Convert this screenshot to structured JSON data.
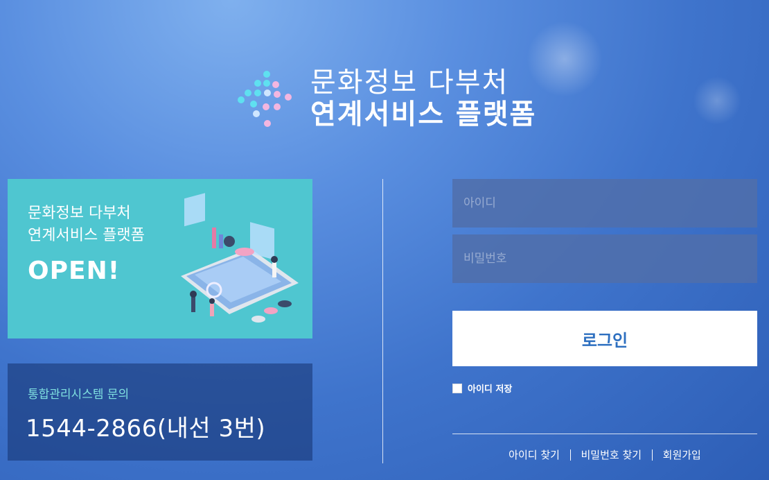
{
  "header": {
    "title_line1": "문화정보 다부처",
    "title_line2": "연계서비스 플랫폼"
  },
  "banner": {
    "line1": "문화정보 다부처",
    "line2": "연계서비스 플랫폼",
    "headline": "OPEN!"
  },
  "contact": {
    "label": "통합관리시스템 문의",
    "number": "1544-2866(내선 3번)"
  },
  "login": {
    "id_placeholder": "아이디",
    "password_placeholder": "비밀번호",
    "button_label": "로그인",
    "save_id_label": "아이디 저장"
  },
  "links": {
    "find_id": "아이디 찾기",
    "find_password": "비밀번호 찾기",
    "signup": "회원가입"
  },
  "colors": {
    "banner_bg": "#4fc6d0",
    "login_text": "#2d6fc0",
    "contact_label": "#7fe0e0"
  }
}
